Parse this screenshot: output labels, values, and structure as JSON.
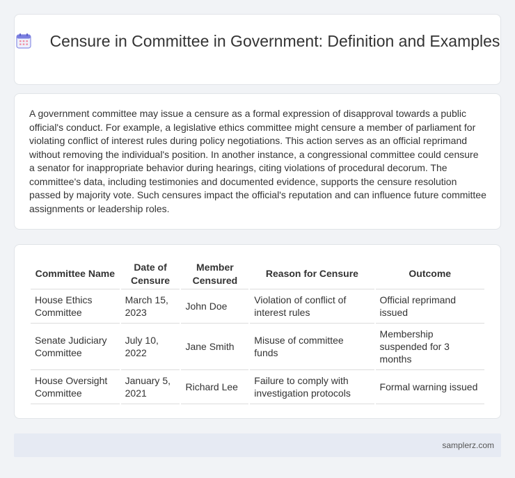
{
  "header": {
    "title": "Censure in Committee in Government: Definition and Examples",
    "icon": "calendar-icon"
  },
  "intro": {
    "text": "A government committee may issue a censure as a formal expression of disapproval towards a public official's conduct. For example, a legislative ethics committee might censure a member of parliament for violating conflict of interest rules during policy negotiations. This action serves as an official reprimand without removing the individual's position. In another instance, a congressional committee could censure a senator for inappropriate behavior during hearings, citing violations of procedural decorum. The committee's data, including testimonies and documented evidence, supports the censure resolution passed by majority vote. Such censures impact the official's reputation and can influence future committee assignments or leadership roles."
  },
  "table": {
    "headers": [
      "Committee Name",
      "Date of Censure",
      "Member Censured",
      "Reason for Censure",
      "Outcome"
    ],
    "rows": [
      [
        "House Ethics Committee",
        "March 15, 2023",
        "John Doe",
        "Violation of conflict of interest rules",
        "Official reprimand issued"
      ],
      [
        "Senate Judiciary Committee",
        "July 10, 2022",
        "Jane Smith",
        "Misuse of committee funds",
        "Membership suspended for 3 months"
      ],
      [
        "House Oversight Committee",
        "January 5, 2021",
        "Richard Lee",
        "Failure to comply with investigation protocols",
        "Formal warning issued"
      ]
    ]
  },
  "footer": {
    "site": "samplerz.com"
  },
  "colors": {
    "page_bg": "#f1f3f6",
    "card_bg": "#ffffff",
    "footer_bg": "#e6eaf3",
    "icon_accent": "#7b7fe0"
  }
}
